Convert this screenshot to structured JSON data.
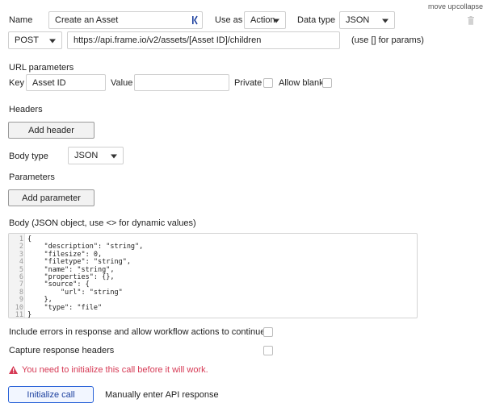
{
  "top_links": {
    "move_up": "move up",
    "collapse": "collapse",
    "trash_icon": "trash-icon"
  },
  "row1": {
    "name_label": "Name",
    "name_value": "Create an Asset",
    "use_as_label": "Use as",
    "use_as_value": "Action",
    "data_type_label": "Data type",
    "data_type_value": "JSON"
  },
  "row2": {
    "method_value": "POST",
    "url_value": "https://api.frame.io/v2/assets/[Asset ID]/children",
    "params_hint": "(use [] for params)"
  },
  "url_params": {
    "title": "URL parameters",
    "key_label": "Key",
    "key_value": "Asset ID",
    "value_label": "Value",
    "value_value": "",
    "private_label": "Private",
    "allow_blank_label": "Allow blank"
  },
  "headers": {
    "title": "Headers",
    "add_button": "Add header"
  },
  "body_type": {
    "label": "Body type",
    "value": "JSON"
  },
  "parameters": {
    "title": "Parameters",
    "add_button": "Add parameter"
  },
  "body": {
    "label": "Body (JSON object, use <> for dynamic values)",
    "lines": [
      "{",
      "    \"description\": \"string\",",
      "    \"filesize\": 0,",
      "    \"filetype\": \"string\",",
      "    \"name\": \"string\",",
      "    \"properties\": {},",
      "    \"source\": {",
      "        \"url\": \"string\"",
      "    },",
      "    \"type\": \"file\"",
      "}"
    ],
    "line_numbers": [
      "1",
      "2",
      "3",
      "4",
      "5",
      "6",
      "7",
      "8",
      "9",
      "10",
      "11"
    ]
  },
  "options": {
    "include_errors_label": "Include errors in response and allow workflow actions to continue",
    "capture_headers_label": "Capture response headers"
  },
  "warning": {
    "text": "You need to initialize this call before it will work.",
    "color": "#d63a55"
  },
  "actions": {
    "initialize_button": "Initialize call",
    "manual_label": "Manually enter API response"
  },
  "colors": {
    "accent": "#2a63d8",
    "warning": "#d63a55"
  }
}
